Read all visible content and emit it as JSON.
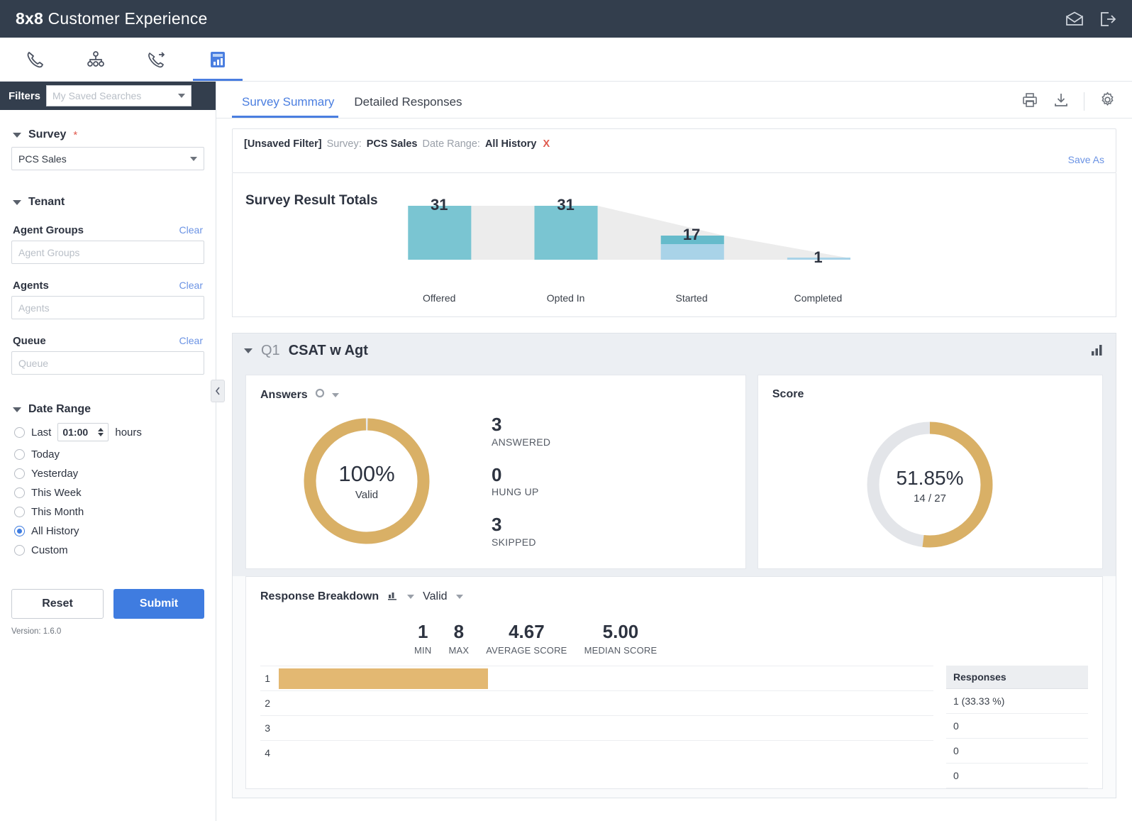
{
  "header": {
    "brand_bold": "8x8",
    "brand_rest": "Customer Experience",
    "mail_icon": "envelope-icon",
    "logout_icon": "logout-icon"
  },
  "apptabs": [
    {
      "icon": "phone-icon",
      "name": "phone"
    },
    {
      "icon": "org-chart-icon",
      "name": "org-chart"
    },
    {
      "icon": "phone-transfer-icon",
      "name": "phone-transfer"
    },
    {
      "icon": "reports-bar-chart-icon",
      "name": "reports",
      "active": true
    }
  ],
  "sidebar": {
    "filters_label": "Filters",
    "saved_searches_placeholder": "My Saved Searches",
    "survey": {
      "title": "Survey",
      "required_mark": "*",
      "value": "PCS Sales"
    },
    "tenant": {
      "title": "Tenant",
      "agent_groups": {
        "label": "Agent Groups",
        "clear": "Clear",
        "placeholder": "Agent Groups",
        "value": ""
      },
      "agents": {
        "label": "Agents",
        "clear": "Clear",
        "placeholder": "Agents",
        "value": ""
      },
      "queue": {
        "label": "Queue",
        "clear": "Clear",
        "placeholder": "Queue",
        "value": ""
      }
    },
    "date_range": {
      "title": "Date Range",
      "last_label": "Last",
      "last_value": "01:00",
      "hours_label": "hours",
      "options": [
        "Today",
        "Yesterday",
        "This Week",
        "This Month",
        "All History",
        "Custom"
      ],
      "selected": "All History"
    },
    "reset_label": "Reset",
    "submit_label": "Submit",
    "version": "Version: 1.6.0",
    "collapse_icon": "chevron-left-icon"
  },
  "main": {
    "tabs": [
      {
        "label": "Survey Summary",
        "active": true
      },
      {
        "label": "Detailed Responses",
        "active": false
      }
    ],
    "toolbar": {
      "print_icon": "print-icon",
      "download_icon": "download-icon",
      "settings_icon": "gear-icon"
    },
    "filter_bar": {
      "unsaved": "[Unsaved Filter]",
      "survey_key": "Survey:",
      "survey_val": "PCS Sales",
      "date_key": "Date Range:",
      "date_val": "All History",
      "remove": "X",
      "save_as": "Save As"
    },
    "funnel_title": "Survey Result Totals",
    "question": {
      "id": "Q1",
      "name": "CSAT w Agt",
      "chart_icon": "bar-chart-icon"
    },
    "answers": {
      "label": "Answers",
      "donut_icon": "donut-icon",
      "center_pct": "100%",
      "center_sub": "Valid",
      "stats": [
        {
          "value": "3",
          "label": "ANSWERED"
        },
        {
          "value": "0",
          "label": "HUNG UP"
        },
        {
          "value": "3",
          "label": "SKIPPED"
        }
      ]
    },
    "score": {
      "label": "Score",
      "center_pct": "51.85%",
      "center_sub": "14 / 27"
    },
    "response_breakdown": {
      "label": "Response Breakdown",
      "chart_icon": "bar-chart-small-icon",
      "selected": "Valid",
      "metrics": [
        {
          "value": "1",
          "label": "MIN"
        },
        {
          "value": "8",
          "label": "MAX"
        },
        {
          "value": "4.67",
          "label": "AVERAGE SCORE"
        },
        {
          "value": "5.00",
          "label": "MEDIAN SCORE"
        }
      ],
      "table_header": "Responses",
      "rows": [
        {
          "cat": "1",
          "responses": "1 (33.33 %)",
          "value": 1
        },
        {
          "cat": "2",
          "responses": "0",
          "value": 0
        },
        {
          "cat": "3",
          "responses": "0",
          "value": 0
        },
        {
          "cat": "4",
          "responses": "0",
          "value": 0
        }
      ]
    }
  },
  "chart_data": [
    {
      "type": "bar",
      "name": "survey-funnel",
      "title": "Survey Result Totals",
      "categories": [
        "Offered",
        "Opted In",
        "Started",
        "Completed"
      ],
      "values": [
        31,
        31,
        17,
        1
      ],
      "ylim": [
        0,
        31
      ],
      "grid": false,
      "legend": "none",
      "colors": {
        "bar": "#7ac5d2",
        "bar_light": "#a9d3e8",
        "connector": "#ececec"
      }
    },
    {
      "type": "pie",
      "name": "answers-donut",
      "title": "Answers",
      "labels": [
        "Valid"
      ],
      "values": [
        100
      ],
      "unit": "%",
      "center_label": "100%",
      "center_sublabel": "Valid",
      "colors": {
        "fill": "#d9b066",
        "track": "#e7e9ec"
      }
    },
    {
      "type": "pie",
      "name": "score-donut",
      "title": "Score",
      "labels": [
        "Score",
        "Remaining"
      ],
      "values": [
        51.85,
        48.15
      ],
      "unit": "%",
      "center_label": "51.85%",
      "center_sublabel": "14 / 27",
      "colors": {
        "fill": "#d9b066",
        "track": "#e3e5e9"
      }
    },
    {
      "type": "bar",
      "name": "response-breakdown",
      "title": "Response Breakdown",
      "orientation": "horizontal",
      "categories": [
        "1",
        "2",
        "3",
        "4"
      ],
      "values": [
        1,
        0,
        0,
        0
      ],
      "value_labels": [
        "1 (33.33 %)",
        "0",
        "0",
        "0"
      ],
      "xlabel": "",
      "ylabel": "",
      "grid": true,
      "colors": {
        "bar": "#e3b872"
      }
    }
  ]
}
